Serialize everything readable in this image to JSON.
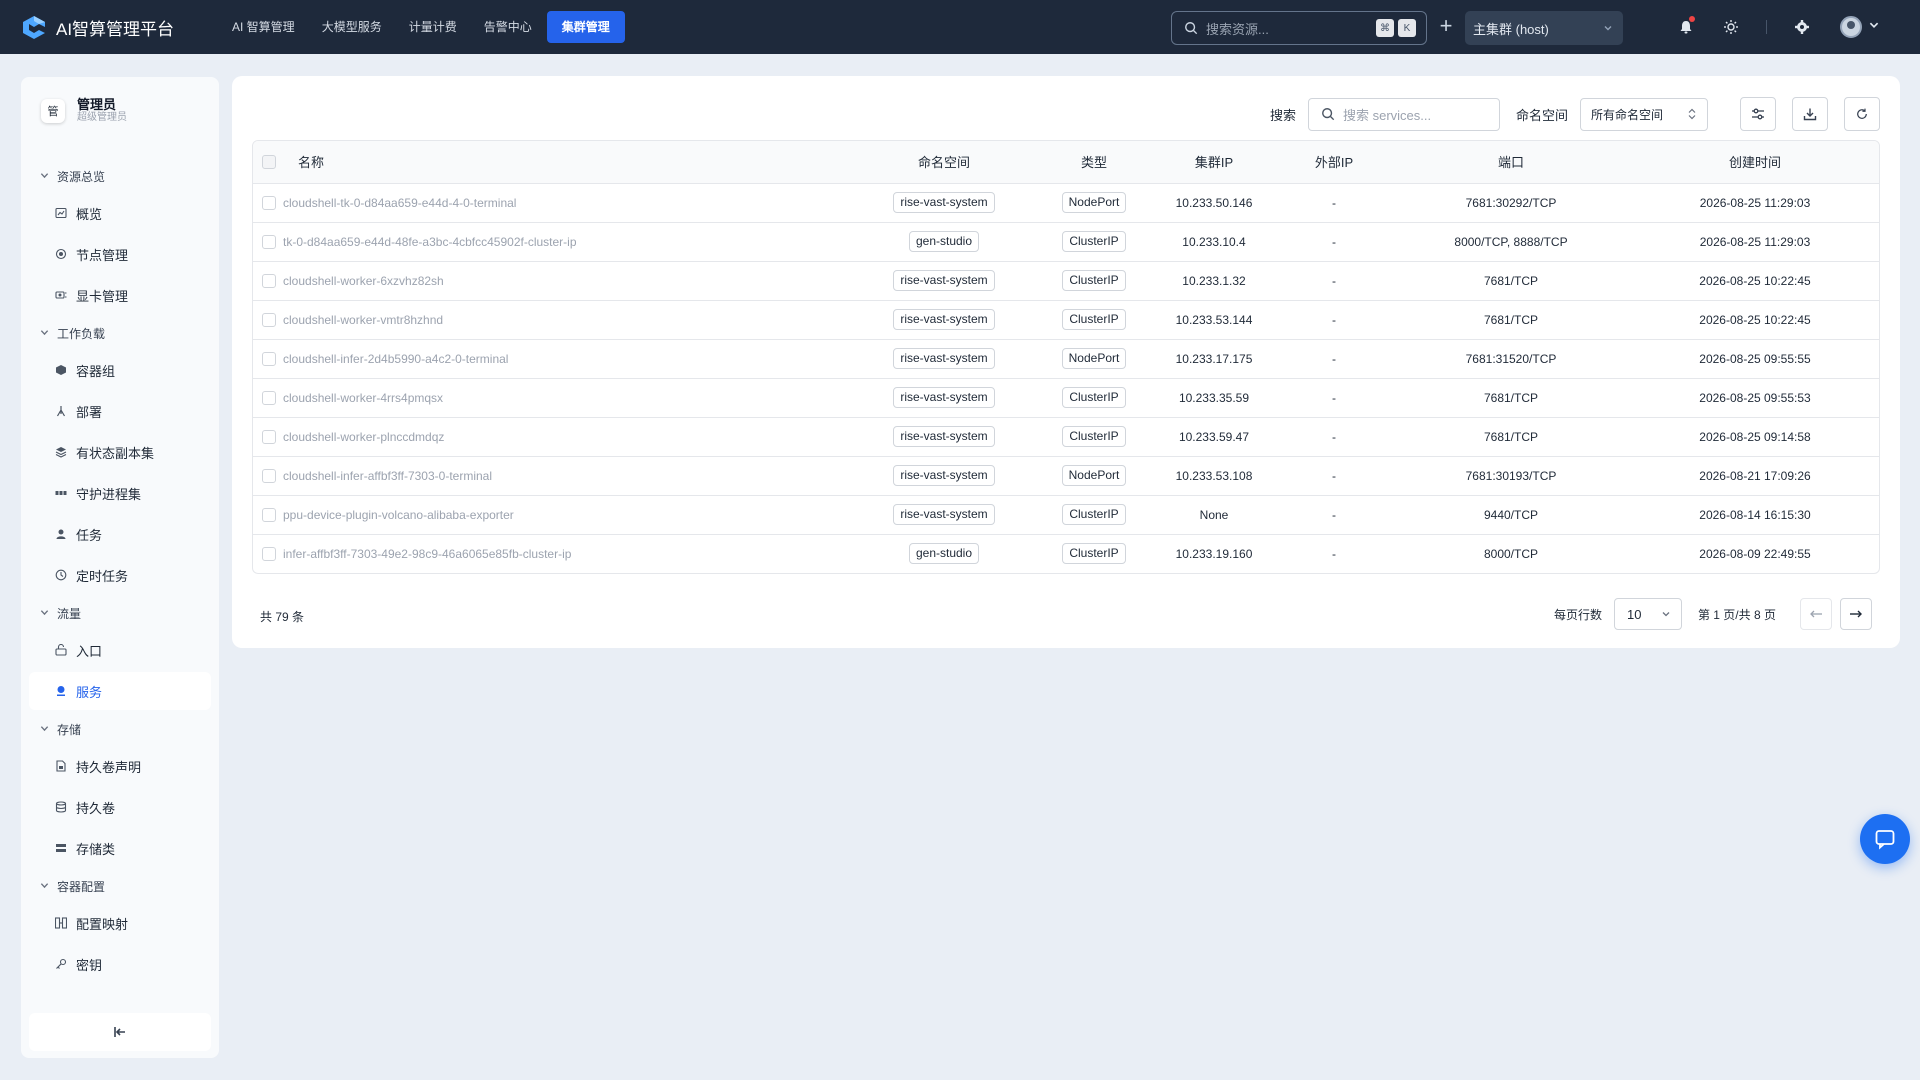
{
  "app": {
    "title": "AI智算管理平台"
  },
  "nav": {
    "items": [
      {
        "label": "AI 智算管理",
        "active": false
      },
      {
        "label": "大模型服务",
        "active": false
      },
      {
        "label": "计量计费",
        "active": false
      },
      {
        "label": "告警中心",
        "active": false
      },
      {
        "label": "集群管理",
        "active": true
      }
    ]
  },
  "topbar": {
    "search_placeholder": "搜索资源...",
    "shortcut_keys": [
      "⌘",
      "K"
    ],
    "cluster": "主集群 (host)"
  },
  "user": {
    "avatar_text": "管",
    "name": "管理员",
    "role": "超级管理员"
  },
  "sidebar": {
    "groups": [
      {
        "label": "资源总览",
        "items": [
          {
            "label": "概览",
            "icon": "dashboard-icon"
          },
          {
            "label": "节点管理",
            "icon": "node-icon"
          },
          {
            "label": "显卡管理",
            "icon": "gpu-icon"
          }
        ]
      },
      {
        "label": "工作负载",
        "items": [
          {
            "label": "容器组",
            "icon": "pod-icon"
          },
          {
            "label": "部署",
            "icon": "deployment-icon"
          },
          {
            "label": "有状态副本集",
            "icon": "statefulset-icon"
          },
          {
            "label": "守护进程集",
            "icon": "daemonset-icon"
          },
          {
            "label": "任务",
            "icon": "job-icon"
          },
          {
            "label": "定时任务",
            "icon": "cronjob-icon"
          }
        ]
      },
      {
        "label": "流量",
        "items": [
          {
            "label": "入口",
            "icon": "ingress-icon"
          },
          {
            "label": "服务",
            "icon": "service-icon",
            "active": true
          }
        ]
      },
      {
        "label": "存储",
        "items": [
          {
            "label": "持久卷声明",
            "icon": "pvc-icon"
          },
          {
            "label": "持久卷",
            "icon": "pv-icon"
          },
          {
            "label": "存储类",
            "icon": "storageclass-icon"
          }
        ]
      },
      {
        "label": "容器配置",
        "items": [
          {
            "label": "配置映射",
            "icon": "configmap-icon"
          },
          {
            "label": "密钥",
            "icon": "secret-icon"
          }
        ]
      }
    ],
    "collapse_icon": "collapse-left-icon"
  },
  "toolbar": {
    "search_label": "搜索",
    "search_placeholder": "搜索 services...",
    "namespace_label": "命名空间",
    "namespace_value": "所有命名空间"
  },
  "table": {
    "columns": [
      "名称",
      "命名空间",
      "类型",
      "集群IP",
      "外部IP",
      "端口",
      "创建时间"
    ],
    "rows": [
      {
        "name": "cloudshell-tk-0-d84aa659-e44d-4-0-terminal",
        "namespace": "rise-vast-system",
        "type": "NodePort",
        "cluster_ip": "10.233.50.146",
        "external_ip": "-",
        "ports": "7681:30292/TCP",
        "created": "2026-08-25 11:29:03"
      },
      {
        "name": "tk-0-d84aa659-e44d-48fe-a3bc-4cbfcc45902f-cluster-ip",
        "namespace": "gen-studio",
        "type": "ClusterIP",
        "cluster_ip": "10.233.10.4",
        "external_ip": "-",
        "ports": "8000/TCP, 8888/TCP",
        "created": "2026-08-25 11:29:03"
      },
      {
        "name": "cloudshell-worker-6xzvhz82sh",
        "namespace": "rise-vast-system",
        "type": "ClusterIP",
        "cluster_ip": "10.233.1.32",
        "external_ip": "-",
        "ports": "7681/TCP",
        "created": "2026-08-25 10:22:45"
      },
      {
        "name": "cloudshell-worker-vmtr8hzhnd",
        "namespace": "rise-vast-system",
        "type": "ClusterIP",
        "cluster_ip": "10.233.53.144",
        "external_ip": "-",
        "ports": "7681/TCP",
        "created": "2026-08-25 10:22:45"
      },
      {
        "name": "cloudshell-infer-2d4b5990-a4c2-0-terminal",
        "namespace": "rise-vast-system",
        "type": "NodePort",
        "cluster_ip": "10.233.17.175",
        "external_ip": "-",
        "ports": "7681:31520/TCP",
        "created": "2026-08-25 09:55:55"
      },
      {
        "name": "cloudshell-worker-4rrs4pmqsx",
        "namespace": "rise-vast-system",
        "type": "ClusterIP",
        "cluster_ip": "10.233.35.59",
        "external_ip": "-",
        "ports": "7681/TCP",
        "created": "2026-08-25 09:55:53"
      },
      {
        "name": "cloudshell-worker-plnccdmdqz",
        "namespace": "rise-vast-system",
        "type": "ClusterIP",
        "cluster_ip": "10.233.59.47",
        "external_ip": "-",
        "ports": "7681/TCP",
        "created": "2026-08-25 09:14:58"
      },
      {
        "name": "cloudshell-infer-affbf3ff-7303-0-terminal",
        "namespace": "rise-vast-system",
        "type": "NodePort",
        "cluster_ip": "10.233.53.108",
        "external_ip": "-",
        "ports": "7681:30193/TCP",
        "created": "2026-08-21 17:09:26"
      },
      {
        "name": "ppu-device-plugin-volcano-alibaba-exporter",
        "namespace": "rise-vast-system",
        "type": "ClusterIP",
        "cluster_ip": "None",
        "external_ip": "-",
        "ports": "9440/TCP",
        "created": "2026-08-14 16:15:30"
      },
      {
        "name": "infer-affbf3ff-7303-49e2-98c9-46a6065e85fb-cluster-ip",
        "namespace": "gen-studio",
        "type": "ClusterIP",
        "cluster_ip": "10.233.19.160",
        "external_ip": "-",
        "ports": "8000/TCP",
        "created": "2026-08-09 22:49:55"
      }
    ]
  },
  "pagination": {
    "total": "共 79 条",
    "rows_per_page_label": "每页行数",
    "rows_per_page": "10",
    "page_info": "第 1 页/共 8 页",
    "prev_icon": "arrow-left-icon",
    "next_icon": "arrow-right-icon"
  },
  "colors": {
    "topbar_bg": "#1e293b",
    "accent": "#2563eb",
    "page_bg": "#e9eef5",
    "chat_fab": "#1d6ff2",
    "notification_dot": "#ef4444"
  }
}
